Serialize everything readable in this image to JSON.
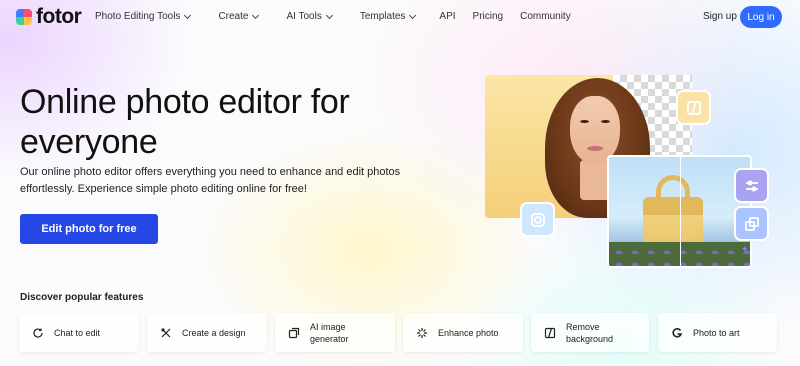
{
  "brand": {
    "name": "fotor"
  },
  "nav": {
    "items": [
      {
        "label": "Photo Editing Tools",
        "has_dropdown": true
      },
      {
        "label": "Create",
        "has_dropdown": true
      },
      {
        "label": "AI Tools",
        "has_dropdown": true
      },
      {
        "label": "Templates",
        "has_dropdown": true
      },
      {
        "label": "API",
        "has_dropdown": false
      },
      {
        "label": "Pricing",
        "has_dropdown": false
      },
      {
        "label": "Community",
        "has_dropdown": false
      }
    ],
    "signup_label": "Sign up",
    "login_label": "Log in"
  },
  "hero": {
    "title": "Online photo editor for everyone",
    "subtitle": "Our online photo editor offers everything you need to enhance and edit photos effortlessly. Experience simple photo editing online for free!",
    "cta_label": "Edit photo for free"
  },
  "features": {
    "heading": "Discover popular features",
    "items": [
      {
        "label": "Chat to edit",
        "icon": "chat-refresh-icon"
      },
      {
        "label": "Create a design",
        "icon": "design-tools-icon"
      },
      {
        "label": "AI image generator",
        "icon": "ai-image-icon"
      },
      {
        "label": "Enhance photo",
        "icon": "enhance-sparkle-icon"
      },
      {
        "label": "Remove background",
        "icon": "remove-background-icon"
      },
      {
        "label": "Photo to art",
        "icon": "photo-to-art-icon"
      }
    ]
  },
  "colors": {
    "login_button": "#2f6bff",
    "cta_button": "#2447e6"
  }
}
